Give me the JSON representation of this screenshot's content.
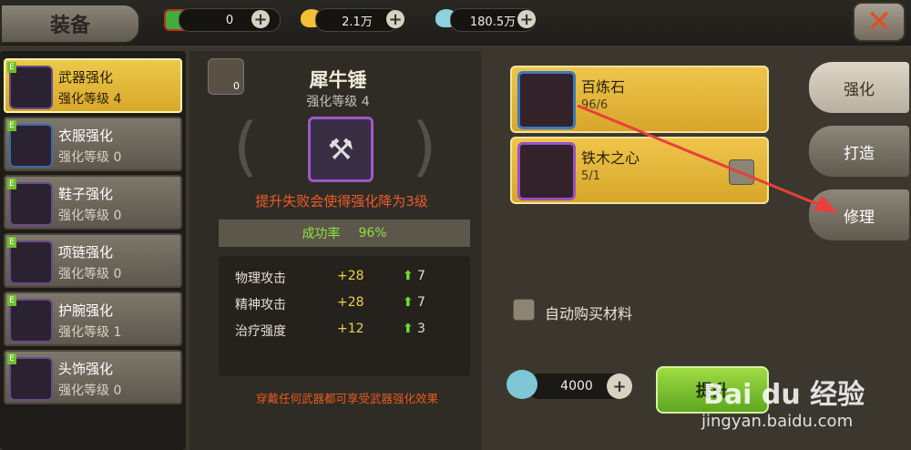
{
  "header": {
    "title": "装备",
    "currencies": [
      {
        "icon": "red-gem-icon",
        "value": "0"
      },
      {
        "icon": "gold-shell-icon",
        "value": "2.1万"
      },
      {
        "icon": "blue-shell-icon",
        "value": "180.5万"
      }
    ],
    "close_icon": "close-icon"
  },
  "left_list": [
    {
      "name": "武器强化",
      "level": "强化等级 4",
      "active": true
    },
    {
      "name": "衣服强化",
      "level": "强化等级 0"
    },
    {
      "name": "鞋子强化",
      "level": "强化等级 0"
    },
    {
      "name": "项链强化",
      "level": "强化等级 0"
    },
    {
      "name": "护腕强化",
      "level": "强化等级 1"
    },
    {
      "name": "头饰强化",
      "level": "强化等级 0"
    }
  ],
  "center": {
    "armor_count": "0",
    "weapon_name": "犀牛锤",
    "weapon_level": "强化等级 4",
    "warning": "提升失败会使得强化降为3级",
    "success_label": "成功率",
    "success_value": "96%",
    "stats": [
      {
        "name": "物理攻击",
        "value": "+28",
        "gain": "7"
      },
      {
        "name": "精神攻击",
        "value": "+28",
        "gain": "7"
      },
      {
        "name": "治疗强度",
        "value": "+12",
        "gain": "3"
      }
    ],
    "footnote": "穿戴任何武器都可享受武器强化效果"
  },
  "materials": [
    {
      "name": "百炼石",
      "count": "96/6"
    },
    {
      "name": "铁木之心",
      "count": "5/1"
    }
  ],
  "tabs": {
    "enhance": "强化",
    "forge": "打造",
    "repair": "修理"
  },
  "auto_buy_label": "自动购买材料",
  "cost": "4000",
  "confirm_label": "提升",
  "watermark": {
    "brand": "Bai du 经验",
    "url": "jingyan.baidu.com"
  },
  "colors": {
    "accent_gold": "#e6bb3f",
    "warning_red": "#f05a28",
    "success_green": "#6fdc2a",
    "annotation_arrow": "#e8403a"
  }
}
